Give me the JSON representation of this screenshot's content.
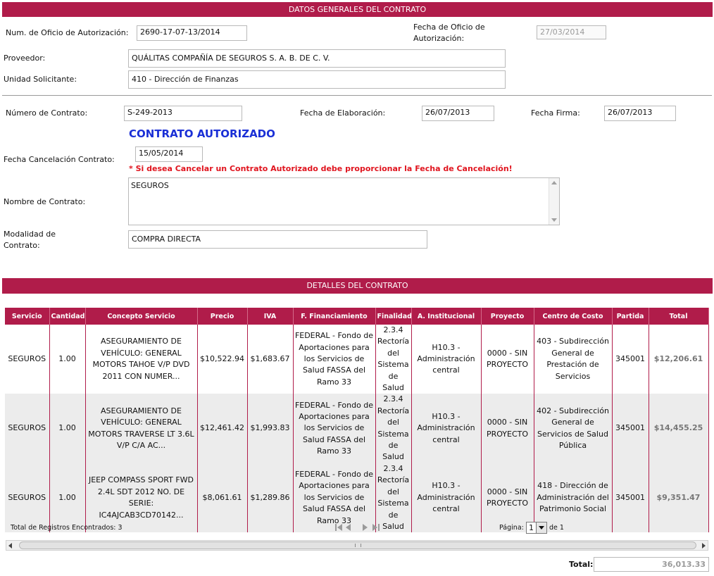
{
  "sections": {
    "general": "DATOS GENERALES DEL CONTRATO",
    "details": "DETALLES DEL CONTRATO"
  },
  "oficio": {
    "label": "Num. de Oficio de Autorización:",
    "value": "2690-17-07-13/2014",
    "fecha_label_1": "Fecha de Oficio de",
    "fecha_label_2": "Autorización:",
    "fecha_value": "27/03/2014"
  },
  "proveedor": {
    "label": "Proveedor:",
    "value": "QUÁLITAS COMPAÑÍA DE SEGUROS S. A. B. DE C. V."
  },
  "unidad": {
    "label": "Unidad Solicitante:",
    "value": "410 - Dirección de Finanzas"
  },
  "contrato": {
    "numero_label": "Número de Contrato:",
    "numero_value": "S-249-2013",
    "elaboracion_label": "Fecha de Elaboración:",
    "elaboracion_value": "26/07/2013",
    "firma_label": "Fecha Firma:",
    "firma_value": "26/07/2013",
    "status": "CONTRATO AUTORIZADO",
    "cancel_label": "Fecha Cancelación Contrato:",
    "cancel_value": "15/05/2014",
    "cancel_warning": "* Si desea Cancelar un Contrato Autorizado debe proporcionar la Fecha de Cancelación!",
    "nombre_label": "Nombre de Contrato:",
    "nombre_value": "SEGUROS",
    "modalidad_label_1": "Modalidad de",
    "modalidad_label_2": "Contrato:",
    "modalidad_value": "COMPRA DIRECTA"
  },
  "colors": {
    "accent": "#b01c4a",
    "status_blue": "#1a2fd6",
    "warning_red": "#e0141e"
  },
  "table": {
    "headers": [
      "Servicio",
      "Cantidad",
      "Concepto Servicio",
      "Precio",
      "IVA",
      "F. Financiamiento",
      "Finalidad",
      "A. Institucional",
      "Proyecto",
      "Centro de Costo",
      "Partida",
      "Total"
    ],
    "rows": [
      [
        "SEGUROS",
        "1.00",
        "ASEGURAMIENTO DE VEHÍCULO: GENERAL MOTORS TAHOE V/P DVD 2011 CON NUMER...",
        "$10,522.94",
        "$1,683.67",
        "FEDERAL - Fondo de Aportaciones para los Servicios de Salud FASSA del Ramo 33",
        "2.3.4 Rectoría del Sistema de Salud",
        "H10.3 - Administración central",
        "0000 - SIN PROYECTO",
        "403 - Subdirección General de Prestación de Servicios",
        "345001",
        "$12,206.61"
      ],
      [
        "SEGUROS",
        "1.00",
        "ASEGURAMIENTO DE VEHÍCULO: GENERAL MOTORS TRAVERSE LT 3.6L V/P C/A AC...",
        "$12,461.42",
        "$1,993.83",
        "FEDERAL - Fondo de Aportaciones para los Servicios de Salud FASSA del Ramo 33",
        "2.3.4 Rectoría del Sistema de Salud",
        "H10.3 - Administración central",
        "0000 - SIN PROYECTO",
        "402 - Subdirección General de Servicios de Salud Pública",
        "345001",
        "$14,455.25"
      ],
      [
        "SEGUROS",
        "1.00",
        "JEEP COMPASS SPORT FWD 2.4L SDT 2012 NO. DE SERIE: IC4AJCAB3CD70142...",
        "$8,061.61",
        "$1,289.86",
        "FEDERAL - Fondo de Aportaciones para los Servicios de Salud FASSA del Ramo 33",
        "2.3.4 Rectoría del Sistema de Salud",
        "H10.3 - Administración central",
        "0000 - SIN PROYECTO",
        "418 - Dirección de Administración del Patrimonio Social",
        "345001",
        "$9,351.47"
      ]
    ]
  },
  "pager": {
    "records_label": "Total de Registros Encontrados: 3",
    "page_label": "Página:",
    "page_value": "1",
    "of_label": "de 1"
  },
  "total": {
    "label": "Total:",
    "value": "36,013.33"
  }
}
